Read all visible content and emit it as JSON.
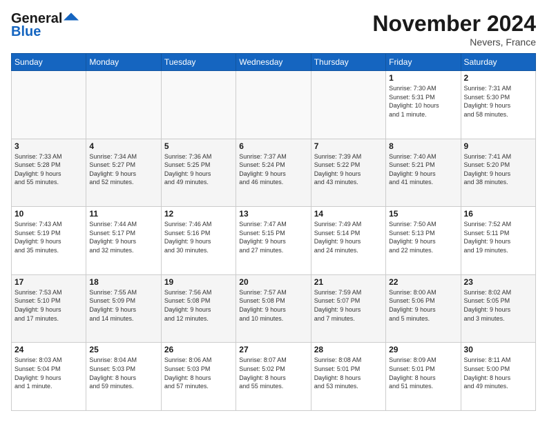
{
  "header": {
    "logo_line1": "General",
    "logo_line2": "Blue",
    "month": "November 2024",
    "location": "Nevers, France"
  },
  "weekdays": [
    "Sunday",
    "Monday",
    "Tuesday",
    "Wednesday",
    "Thursday",
    "Friday",
    "Saturday"
  ],
  "weeks": [
    [
      {
        "day": "",
        "info": ""
      },
      {
        "day": "",
        "info": ""
      },
      {
        "day": "",
        "info": ""
      },
      {
        "day": "",
        "info": ""
      },
      {
        "day": "",
        "info": ""
      },
      {
        "day": "1",
        "info": "Sunrise: 7:30 AM\nSunset: 5:31 PM\nDaylight: 10 hours\nand 1 minute."
      },
      {
        "day": "2",
        "info": "Sunrise: 7:31 AM\nSunset: 5:30 PM\nDaylight: 9 hours\nand 58 minutes."
      }
    ],
    [
      {
        "day": "3",
        "info": "Sunrise: 7:33 AM\nSunset: 5:28 PM\nDaylight: 9 hours\nand 55 minutes."
      },
      {
        "day": "4",
        "info": "Sunrise: 7:34 AM\nSunset: 5:27 PM\nDaylight: 9 hours\nand 52 minutes."
      },
      {
        "day": "5",
        "info": "Sunrise: 7:36 AM\nSunset: 5:25 PM\nDaylight: 9 hours\nand 49 minutes."
      },
      {
        "day": "6",
        "info": "Sunrise: 7:37 AM\nSunset: 5:24 PM\nDaylight: 9 hours\nand 46 minutes."
      },
      {
        "day": "7",
        "info": "Sunrise: 7:39 AM\nSunset: 5:22 PM\nDaylight: 9 hours\nand 43 minutes."
      },
      {
        "day": "8",
        "info": "Sunrise: 7:40 AM\nSunset: 5:21 PM\nDaylight: 9 hours\nand 41 minutes."
      },
      {
        "day": "9",
        "info": "Sunrise: 7:41 AM\nSunset: 5:20 PM\nDaylight: 9 hours\nand 38 minutes."
      }
    ],
    [
      {
        "day": "10",
        "info": "Sunrise: 7:43 AM\nSunset: 5:19 PM\nDaylight: 9 hours\nand 35 minutes."
      },
      {
        "day": "11",
        "info": "Sunrise: 7:44 AM\nSunset: 5:17 PM\nDaylight: 9 hours\nand 32 minutes."
      },
      {
        "day": "12",
        "info": "Sunrise: 7:46 AM\nSunset: 5:16 PM\nDaylight: 9 hours\nand 30 minutes."
      },
      {
        "day": "13",
        "info": "Sunrise: 7:47 AM\nSunset: 5:15 PM\nDaylight: 9 hours\nand 27 minutes."
      },
      {
        "day": "14",
        "info": "Sunrise: 7:49 AM\nSunset: 5:14 PM\nDaylight: 9 hours\nand 24 minutes."
      },
      {
        "day": "15",
        "info": "Sunrise: 7:50 AM\nSunset: 5:13 PM\nDaylight: 9 hours\nand 22 minutes."
      },
      {
        "day": "16",
        "info": "Sunrise: 7:52 AM\nSunset: 5:11 PM\nDaylight: 9 hours\nand 19 minutes."
      }
    ],
    [
      {
        "day": "17",
        "info": "Sunrise: 7:53 AM\nSunset: 5:10 PM\nDaylight: 9 hours\nand 17 minutes."
      },
      {
        "day": "18",
        "info": "Sunrise: 7:55 AM\nSunset: 5:09 PM\nDaylight: 9 hours\nand 14 minutes."
      },
      {
        "day": "19",
        "info": "Sunrise: 7:56 AM\nSunset: 5:08 PM\nDaylight: 9 hours\nand 12 minutes."
      },
      {
        "day": "20",
        "info": "Sunrise: 7:57 AM\nSunset: 5:08 PM\nDaylight: 9 hours\nand 10 minutes."
      },
      {
        "day": "21",
        "info": "Sunrise: 7:59 AM\nSunset: 5:07 PM\nDaylight: 9 hours\nand 7 minutes."
      },
      {
        "day": "22",
        "info": "Sunrise: 8:00 AM\nSunset: 5:06 PM\nDaylight: 9 hours\nand 5 minutes."
      },
      {
        "day": "23",
        "info": "Sunrise: 8:02 AM\nSunset: 5:05 PM\nDaylight: 9 hours\nand 3 minutes."
      }
    ],
    [
      {
        "day": "24",
        "info": "Sunrise: 8:03 AM\nSunset: 5:04 PM\nDaylight: 9 hours\nand 1 minute."
      },
      {
        "day": "25",
        "info": "Sunrise: 8:04 AM\nSunset: 5:03 PM\nDaylight: 8 hours\nand 59 minutes."
      },
      {
        "day": "26",
        "info": "Sunrise: 8:06 AM\nSunset: 5:03 PM\nDaylight: 8 hours\nand 57 minutes."
      },
      {
        "day": "27",
        "info": "Sunrise: 8:07 AM\nSunset: 5:02 PM\nDaylight: 8 hours\nand 55 minutes."
      },
      {
        "day": "28",
        "info": "Sunrise: 8:08 AM\nSunset: 5:01 PM\nDaylight: 8 hours\nand 53 minutes."
      },
      {
        "day": "29",
        "info": "Sunrise: 8:09 AM\nSunset: 5:01 PM\nDaylight: 8 hours\nand 51 minutes."
      },
      {
        "day": "30",
        "info": "Sunrise: 8:11 AM\nSunset: 5:00 PM\nDaylight: 8 hours\nand 49 minutes."
      }
    ]
  ]
}
